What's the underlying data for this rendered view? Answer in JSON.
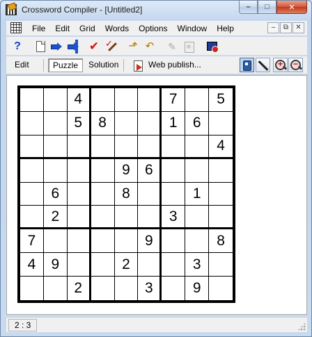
{
  "window": {
    "title": "Crossword Compiler - [Untitled2]",
    "caption_buttons": {
      "minimize": "–",
      "maximize": "□",
      "close": "✕"
    }
  },
  "menubar": {
    "items": [
      "File",
      "Edit",
      "Grid",
      "Words",
      "Options",
      "Window",
      "Help"
    ],
    "mdi_buttons": {
      "minimize": "–",
      "restore": "⧉",
      "close": "✕"
    }
  },
  "toolbar": {
    "icons": [
      "help-icon",
      "new-file-icon",
      "import-icon",
      "export-icon",
      "check-icon",
      "auto-fill-icon",
      "arrow-icon",
      "undo-icon",
      "pencil-disabled-icon",
      "replace-disabled-icon",
      "screen-icon"
    ],
    "help_glyph": "?",
    "check_glyph": "✔",
    "arrow_glyph": "⬏",
    "undo_glyph": "↶",
    "pencil_glyph": "✎"
  },
  "viewbar": {
    "edit_label": "Edit",
    "puzzle_label": "Puzzle",
    "solution_label": "Solution",
    "web_publish_label": "Web publish...",
    "zoom_in_glyph": "+",
    "zoom_out_glyph": "−"
  },
  "puzzle": {
    "rows": [
      [
        "",
        "",
        "4",
        "",
        "",
        "",
        "7",
        "",
        "5"
      ],
      [
        "",
        "",
        "5",
        "8",
        "",
        "",
        "1",
        "6",
        ""
      ],
      [
        "",
        "",
        "",
        "",
        "",
        "",
        "",
        "",
        "4"
      ],
      [
        "",
        "",
        "",
        "",
        "9",
        "6",
        "",
        "",
        ""
      ],
      [
        "",
        "6",
        "",
        "",
        "8",
        "",
        "",
        "1",
        ""
      ],
      [
        "",
        "2",
        "",
        "",
        "",
        "",
        "3",
        "",
        ""
      ],
      [
        "7",
        "",
        "",
        "",
        "",
        "9",
        "",
        "",
        "8"
      ],
      [
        "4",
        "9",
        "",
        "",
        "2",
        "",
        "",
        "3",
        ""
      ],
      [
        "",
        "",
        "2",
        "",
        "",
        "3",
        "",
        "9",
        ""
      ]
    ]
  },
  "statusbar": {
    "position": "2 : 3"
  },
  "colors": {
    "accent": "#c9dcf1",
    "close": "#c3381b",
    "check_red": "#d61010"
  }
}
